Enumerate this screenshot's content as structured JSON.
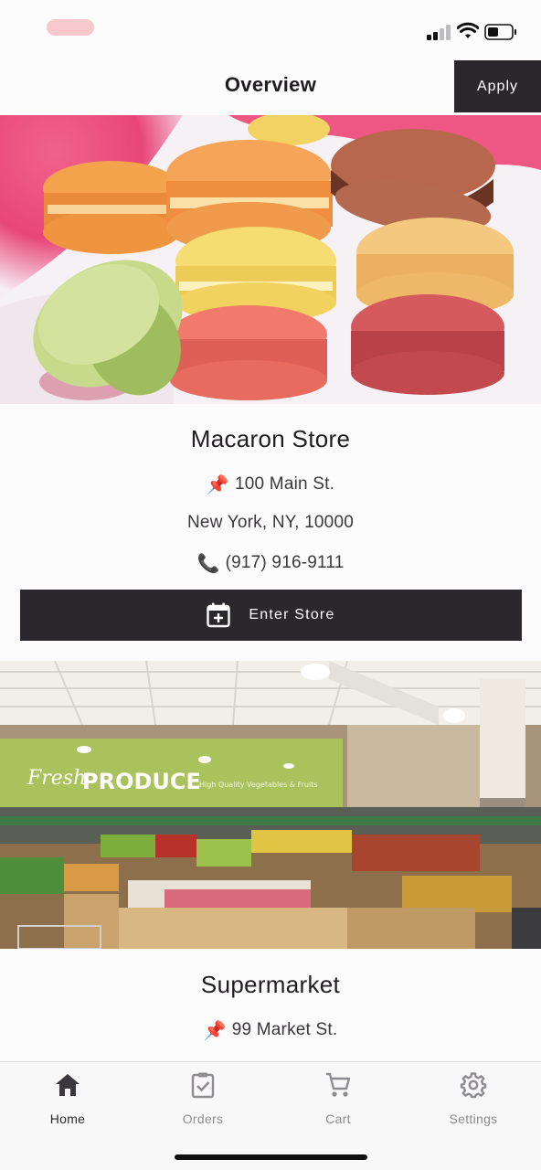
{
  "header": {
    "title": "Overview",
    "apply_label": "Apply"
  },
  "stores": [
    {
      "name": "Macaron Store",
      "address_icon": "pushpin-icon",
      "address": "100 Main St.",
      "city": "New York, NY, 10000",
      "phone_icon": "phone-icon",
      "phone": "(917) 916-9111",
      "enter_label": "Enter Store"
    },
    {
      "name": "Supermarket",
      "address_icon": "pushpin-icon",
      "address": "99 Market St.",
      "sign": {
        "fresh": "Fresh",
        "produce": "PRODUCE",
        "tagline": "High Quality Vegetables & Fruits"
      }
    }
  ],
  "tabs": [
    {
      "label": "Home",
      "icon": "home-icon",
      "active": true
    },
    {
      "label": "Orders",
      "icon": "clipboard-check-icon",
      "active": false
    },
    {
      "label": "Cart",
      "icon": "cart-icon",
      "active": false
    },
    {
      "label": "Settings",
      "icon": "gear-icon",
      "active": false
    }
  ],
  "colors": {
    "dark": "#2a282c",
    "tab_inactive": "#8e8c90",
    "background": "#fdfcfd"
  }
}
